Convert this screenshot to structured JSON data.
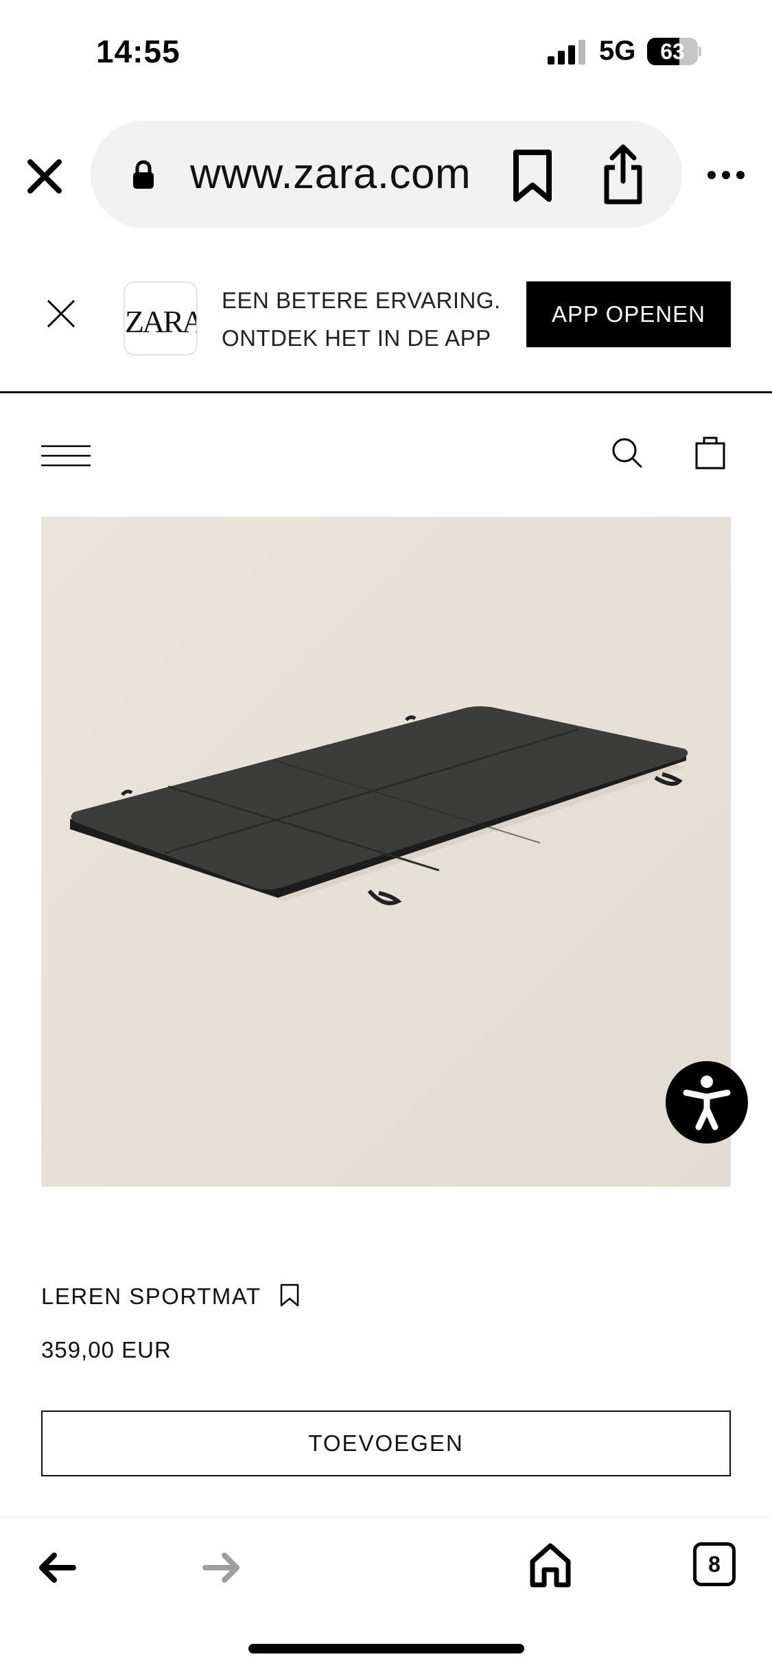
{
  "status_bar": {
    "time": "14:55",
    "network": "5G",
    "battery": "63",
    "battery_level": 0.63,
    "icons": [
      "signal-icon",
      "battery-icon"
    ]
  },
  "browser": {
    "url": "www.zara.com",
    "icons": [
      "close-icon",
      "lock-icon",
      "bookmark-icon",
      "share-icon",
      "more-icon"
    ]
  },
  "app_banner": {
    "logo_text": "ZARA",
    "line1": "EEN BETERE ERVARING.",
    "line2": "ONTDEK HET IN DE APP",
    "cta_label": "APP OPENEN"
  },
  "header": {
    "icons": [
      "menu-icon",
      "search-icon",
      "shopping-bag-icon"
    ]
  },
  "product": {
    "name": "LEREN SPORTMAT",
    "price": "359,00 EUR",
    "add_label": "TOEVOEGEN",
    "image_bg_color": "#e6e2d9"
  },
  "toolbar": {
    "tabs_count": "8",
    "icons": [
      "back-arrow-icon",
      "forward-arrow-icon",
      "home-icon",
      "tabs-icon"
    ]
  },
  "colors": {
    "accent": "#000000",
    "url_bar_bg": "#f1f1f2",
    "forward_disabled": "#9e9e9e"
  }
}
